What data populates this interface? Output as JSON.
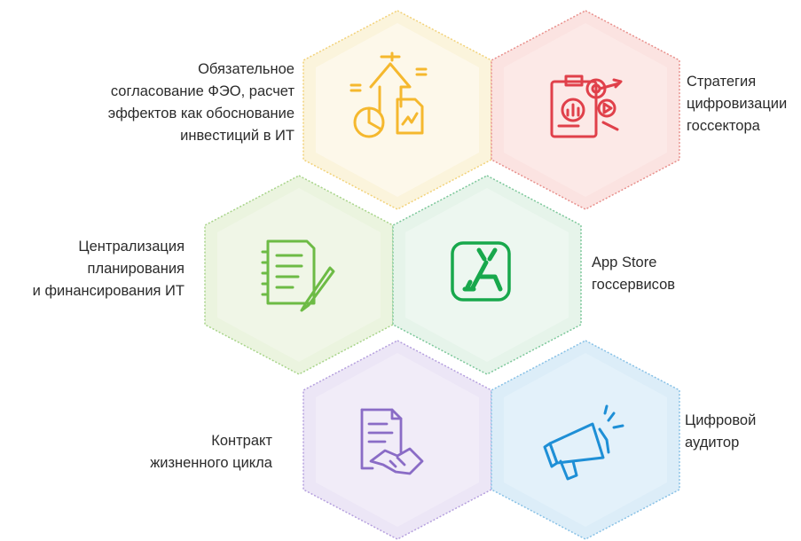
{
  "colors": {
    "yellow": "#f7c94a",
    "red": "#e0404a",
    "green": "#76c04a",
    "teal": "#18a84c",
    "purple": "#8a6cc6",
    "blue": "#1e8fd6"
  },
  "cells": [
    {
      "key": "feo",
      "color": "yellow",
      "icon": "finance-growth-icon",
      "lines": [
        "Обязательное",
        "согласование ФЭО, расчет",
        "эффектов как обоснование",
        "инвестиций в ИТ"
      ]
    },
    {
      "key": "strategy",
      "color": "red",
      "icon": "strategy-target-icon",
      "lines": [
        "Стратегия",
        "цифровизации",
        "госсектора"
      ]
    },
    {
      "key": "planning",
      "color": "green",
      "icon": "notebook-pen-icon",
      "lines": [
        "Централизация",
        "планирования",
        "и финансирования ИТ"
      ]
    },
    {
      "key": "appstore",
      "color": "teal",
      "icon": "app-store-icon",
      "lines": [
        "App Store",
        "госсервисов"
      ]
    },
    {
      "key": "contract",
      "color": "purple",
      "icon": "contract-handshake-icon",
      "lines": [
        "Контракт",
        "жизненного цикла"
      ]
    },
    {
      "key": "auditor",
      "color": "blue",
      "icon": "megaphone-icon",
      "lines": [
        "Цифровой",
        "аудитор"
      ]
    }
  ]
}
